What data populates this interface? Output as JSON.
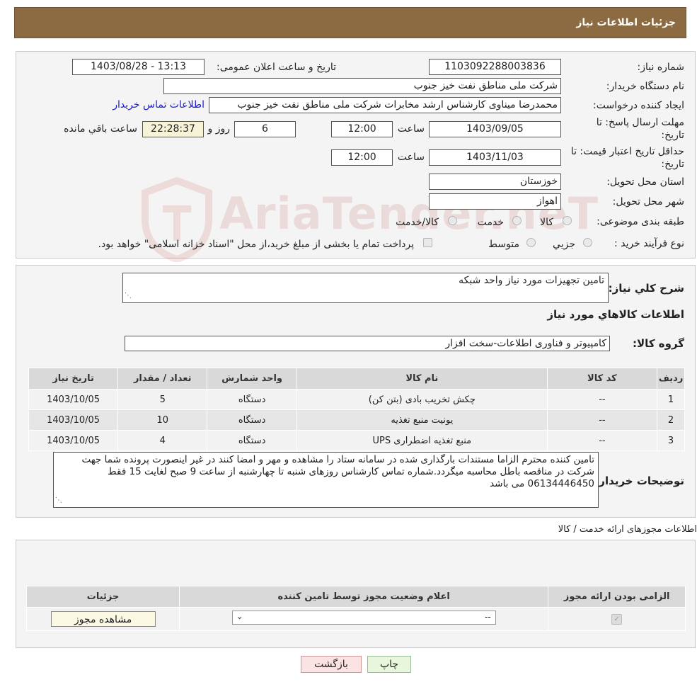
{
  "header": {
    "title": "جزئیات اطلاعات نیاز"
  },
  "form": {
    "need_number_label": "شماره نیاز:",
    "need_number": "1103092288003836",
    "announce_label": "تاریخ و ساعت اعلان عمومی:",
    "announce_value": "1403/08/28 - 13:13",
    "buyer_label": "نام دستگاه خریدار:",
    "buyer_value": "شرکت ملی مناطق نفت خیز جنوب",
    "creator_label": "ایجاد کننده درخواست:",
    "creator_value": "محمدرضا میناوی کارشناس ارشد مخابرات شرکت ملی مناطق نفت خیز جنوب",
    "contact_link": "اطلاعات تماس خریدار",
    "deadline_label_1": "مهلت ارسال پاسخ: تا",
    "deadline_label_2": "تاریخ:",
    "deadline_date": "1403/09/05",
    "time_label": "ساعت",
    "deadline_time": "12:00",
    "days_value": "6",
    "days_label": "روز و",
    "remaining_time": "22:28:37",
    "remaining_label": "ساعت باقي مانده",
    "validity_label_1": "حداقل تاریخ اعتبار قیمت: تا",
    "validity_label_2": "تاریخ:",
    "validity_date": "1403/11/03",
    "validity_time_label": "ساعت",
    "validity_time": "12:00",
    "province_label": "استان محل تحویل:",
    "province_value": "خوزستان",
    "city_label": "شهر محل تحویل:",
    "city_value": "اهواز",
    "category_label": "طبقه بندی موضوعی:",
    "category_options": [
      "کالا",
      "خدمت",
      "کالا/خدمت"
    ],
    "process_label": "نوع فرآیند خرید :",
    "process_options": [
      "جزیي",
      "متوسط"
    ],
    "process_note": "پرداخت تمام یا بخشی از مبلغ خرید،از محل \"اسناد خزانه اسلامی\" خواهد بود."
  },
  "summary": {
    "desc_label": "شرح کلي نیاز:",
    "desc_value": "تامین تجهیزات مورد نیاز واحد شبکه",
    "goods_title": "اطلاعات کالاهاي مورد نیاز",
    "group_label": "گروه کالا:",
    "group_value": "کامپیوتر و فناوری اطلاعات-سخت افزار",
    "table_headers": [
      "ردیف",
      "کد کالا",
      "نام کالا",
      "واحد شمارش",
      "تعداد / مقدار",
      "تاریخ نیاز"
    ],
    "rows": [
      [
        "1",
        "--",
        "چکش تخریب بادی (بتن کن)",
        "دستگاه",
        "5",
        "1403/10/05"
      ],
      [
        "2",
        "--",
        "یونیت منبع تغذیه",
        "دستگاه",
        "10",
        "1403/10/05"
      ],
      [
        "3",
        "--",
        "منبع تغذیه اضطراری UPS",
        "دستگاه",
        "4",
        "1403/10/05"
      ]
    ],
    "buyer_notes_label": "توضیحات خریدار:",
    "buyer_notes": "تامین کننده محترم الزاما مستندات بارگذاری شده در سامانه ستاد را مشاهده و مهر و امضا کنند در غیر اینصورت پرونده شما جهت شرکت در مناقصه باطل محاسبه میگردد.شماره تماس کارشناس روزهای شنبه تا چهارشنبه از ساعت 9 صبح لغایت 15 فقط 06134446450 می باشد"
  },
  "permits": {
    "section_title": "اطلاعات مجوزهای ارائه خدمت / کالا",
    "headers": [
      "الزامی بودن ارائه مجوز",
      "اعلام وضعیت مجوز توسط تامین کننده",
      "جزئیات"
    ],
    "select_value": "--",
    "view_button": "مشاهده مجوز"
  },
  "footer": {
    "back_button": "بازگشت",
    "print_button": "چاپ"
  },
  "watermark": {
    "text": "AriaTender.neT"
  },
  "colors": {
    "header_bg": "#8c6a42",
    "timer_bg": "#f6f3d8",
    "link": "#1a1ad6"
  }
}
